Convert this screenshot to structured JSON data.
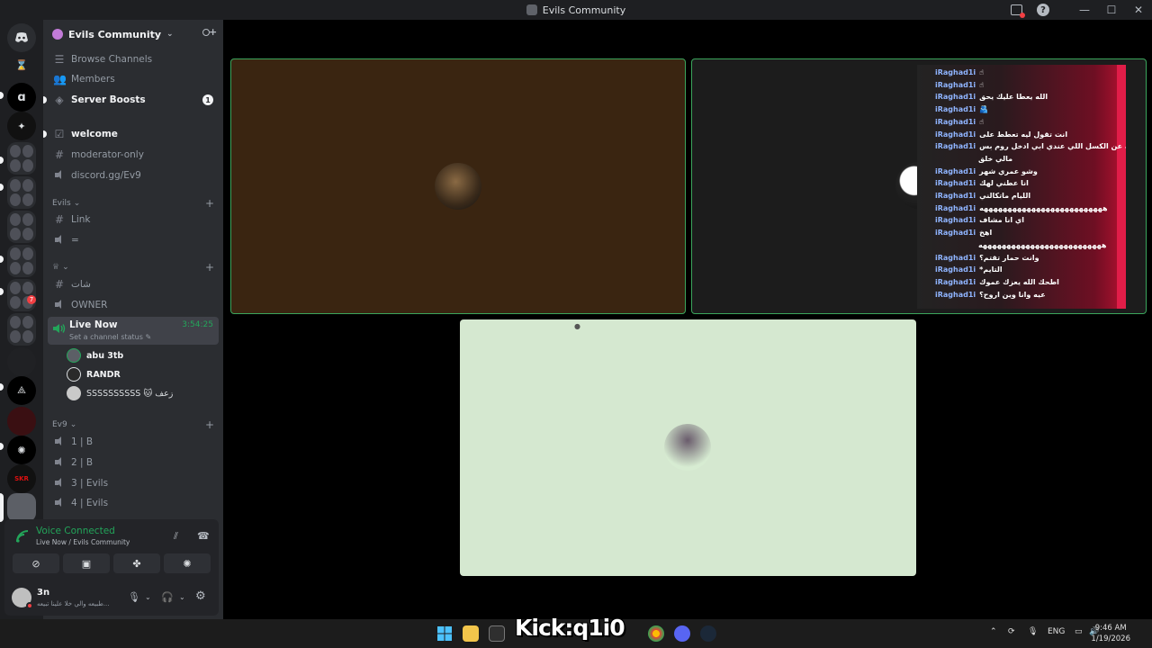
{
  "window": {
    "title": "Evils Community"
  },
  "sidebar": {
    "server_name": "Evils Community",
    "top_items": [
      {
        "label": "Browse Channels",
        "icon": "browse-icon"
      },
      {
        "label": "Members",
        "icon": "members-icon"
      },
      {
        "label": "Server Boosts",
        "icon": "boost-icon",
        "badge": "1"
      }
    ],
    "channels_top": [
      {
        "label": "welcome",
        "icon": "rules-icon"
      },
      {
        "label": "moderator-only",
        "icon": "hash-icon"
      },
      {
        "label": "discord.gg/Ev9",
        "icon": "speaker-icon"
      }
    ],
    "category_evils": {
      "label": "Evils",
      "channels": [
        {
          "label": "Link",
          "icon": "hash-icon"
        },
        {
          "label": "=",
          "icon": "speaker-icon"
        }
      ]
    },
    "category_2": {
      "label": "♕",
      "channels": [
        {
          "label": "شات",
          "icon": "hash-icon"
        },
        {
          "label": "OWNER",
          "icon": "speaker-icon"
        }
      ]
    },
    "live_channel": {
      "label": "Live Now",
      "timer": "3:54:25",
      "status": "Set a channel status"
    },
    "voice_users": [
      {
        "name": "abu 3tb"
      },
      {
        "name": "RANDR"
      },
      {
        "name": "SSSSSSSSSS 🐱 زعف"
      }
    ],
    "category_ev9": {
      "label": "Ev9",
      "channels": [
        {
          "label": "1 | B"
        },
        {
          "label": "2 | B"
        },
        {
          "label": "3 | Evils"
        },
        {
          "label": "4 | Evils"
        }
      ]
    }
  },
  "voice_panel": {
    "title": "Voice Connected",
    "subtitle": "Live Now / Evils Community"
  },
  "user": {
    "name": "3n",
    "status": "طبيعه والي خلا علينا تبيعه..."
  },
  "chat_overlay": {
    "messages": [
      {
        "user": "iRaghad1i",
        "text": "☝"
      },
      {
        "user": "iRaghad1i",
        "text": "☝"
      },
      {
        "user": "iRaghad1i",
        "text": "الله يعطا عليك يحق"
      },
      {
        "user": "iRaghad1i",
        "text": "🫂"
      },
      {
        "user": "iRaghad1i",
        "text": "☝"
      },
      {
        "user": "iRaghad1i",
        "text": "انت تقول ليه تعطط على"
      },
      {
        "user": "iRaghad1i",
        "text": "ابيله عن الكسل اللي عندي ابي ادخل روم بس"
      },
      {
        "user": "",
        "text": "مالي خلق"
      },
      {
        "user": "iRaghad1i",
        "text": "وشو عمري شهر"
      },
      {
        "user": "iRaghad1i",
        "text": "انا عطني لهك"
      },
      {
        "user": "iRaghad1i",
        "text": "الليام ماتكالني"
      },
      {
        "user": "iRaghad1i",
        "text": "ههههههههههههههههههههههههههه"
      },
      {
        "user": "iRaghad1i",
        "text": "اي انا مشاف"
      },
      {
        "user": "iRaghad1i",
        "text": "اهخ"
      },
      {
        "user": "",
        "text": "ههههههههههههههههههههههههههه"
      },
      {
        "user": "iRaghad1i",
        "text": "وانت حمار تقتم؟"
      },
      {
        "user": "iRaghad1i",
        "text": "*التايم"
      },
      {
        "user": "iRaghad1i",
        "text": "اطحك الله يعزك عموك"
      },
      {
        "user": "iRaghad1i",
        "text": "عيه وانا وين اروح؟"
      }
    ]
  },
  "taskbar": {
    "watermark": "Kick:q1i0",
    "lang": "ENG",
    "time": "9:46 AM",
    "date": "1/19/2026"
  }
}
